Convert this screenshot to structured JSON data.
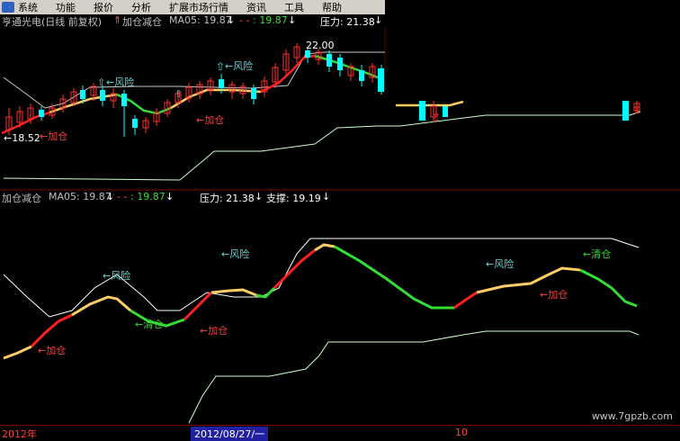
{
  "menu": [
    "系统",
    "功能",
    "报价",
    "分析",
    "扩展市场行情",
    "资讯",
    "工具",
    "帮助"
  ],
  "top_header": {
    "stock": "亨通光电(日线 前复权)",
    "indicator": "加仓减仓",
    "ma_label": "MA05: 19.87",
    "dash_label": "- -",
    "ma_value": ": 19.87",
    "pressure": "压力: 21.38"
  },
  "mid_header": {
    "indicator": "加仓减仓",
    "ma_label": "MA05: 19.87",
    "dash_label": "- -",
    "ma_value": ": 19.87",
    "pressure": "压力: 21.38",
    "support": "支撑: 19.19"
  },
  "top_annotations": {
    "high": "22.00",
    "low": "←18.52",
    "risk1": "←风险",
    "risk2": "←风险",
    "add1": "←加仓",
    "add2": "←加仓"
  },
  "lower_annotations": {
    "risk1": "←风险",
    "risk2": "←风险",
    "risk3": "←风险",
    "clear1": "←清仓",
    "clear2": "←清仓",
    "add1": "←加仓",
    "add2": "←加仓",
    "add3": "←加仓"
  },
  "bottom_bar": {
    "year": "2012年",
    "date": "2012/08/27/一",
    "mark": "10"
  },
  "watermark": "www.7gpzb.com",
  "colors": {
    "up": "#ff3030",
    "down": "#00ffff",
    "red": "#ff2020",
    "orange": "#ffcc66",
    "green": "#33dd33",
    "white_line": "#ffffff",
    "light_green_line": "#ccffcc",
    "label_cyan": "#5fd7d7",
    "label_red": "#ff4040",
    "header_yellow": "#ffff80"
  }
}
